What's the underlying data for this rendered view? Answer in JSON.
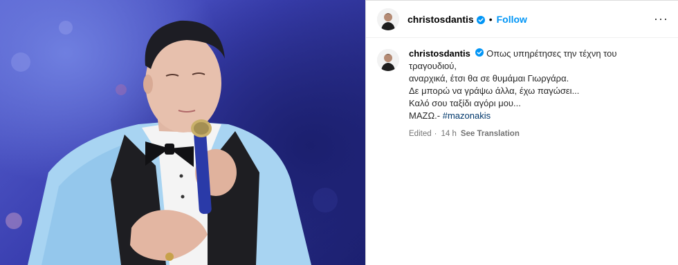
{
  "post": {
    "image_alt": "Performer in light blue tuxedo singing into a microphone",
    "author": "christosdantis",
    "follow_label": "Follow",
    "bullet": "•",
    "more_label": "···"
  },
  "caption": {
    "author": "christosdantis",
    "line1": "Οπως υπηρέτησες την τέχνη του τραγουδιού,",
    "line2": "αναρχικά, έτσι θα σε θυμάμαι Γιωργάρα.",
    "line3": "Δε μπορώ να γράψω άλλα, έχω παγώσει...",
    "line4": "Καλό σου ταξίδι αγόρι μου...",
    "line5_prefix": "ΜΑΖΩ.-",
    "hashtag": "#mazonakis",
    "edited": "Edited",
    "sep": "·",
    "time": "14 h",
    "translation_label": "See Translation"
  },
  "icons": {
    "verified": "verified-badge-icon",
    "more": "more-options-icon"
  },
  "colors": {
    "follow": "#0095f6",
    "verified": "#0095f6",
    "hashtag": "#00376b"
  }
}
